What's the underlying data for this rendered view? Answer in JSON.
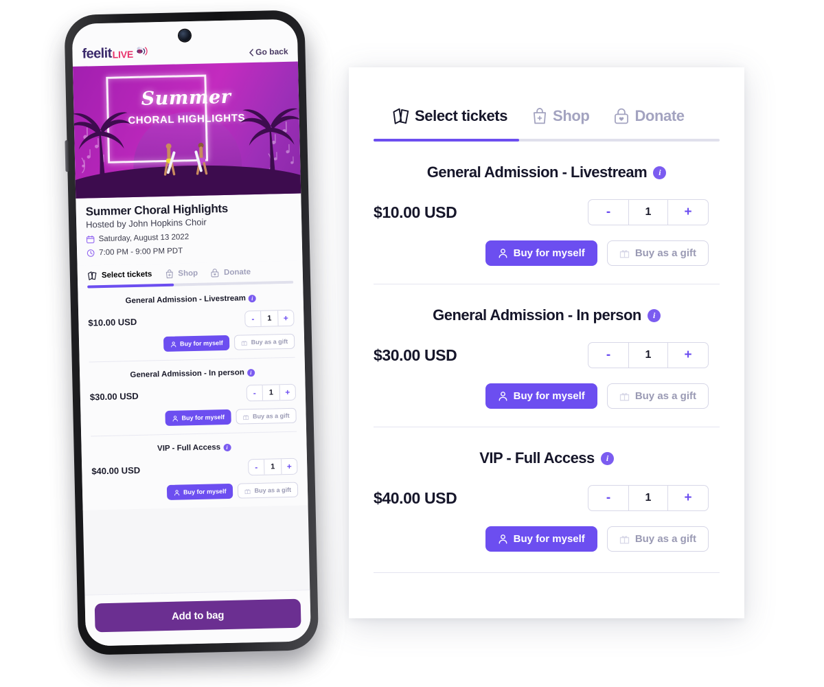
{
  "brand": {
    "logo_primary": "feelit",
    "logo_secondary": "LIVE",
    "accent_purple": "#6C4EF0",
    "accent_dark_purple": "#6B2F91",
    "accent_pink": "#E8356D",
    "muted": "#A0A0BB"
  },
  "phone": {
    "go_back_label": "Go back",
    "hero": {
      "title_script": "Summer",
      "title_caps": "CHORAL HIGHLIGHTS"
    },
    "event": {
      "title": "Summer Choral Highlights",
      "host": "Hosted by John Hopkins Choir",
      "date": "Saturday, August 13 2022",
      "time": "7:00 PM - 9:00 PM PDT"
    },
    "footer": {
      "add_to_bag_label": "Add to bag"
    }
  },
  "tabs": [
    {
      "label": "Select tickets",
      "icon": "tickets-icon",
      "active": true
    },
    {
      "label": "Shop",
      "icon": "shopping-bag-plus-icon",
      "active": false
    },
    {
      "label": "Donate",
      "icon": "donation-box-heart-icon",
      "active": false
    }
  ],
  "tabbar": {
    "progress_percent": 42
  },
  "buttons": {
    "buy_for_myself": "Buy for myself",
    "buy_as_a_gift": "Buy as a gift"
  },
  "stepper": {
    "decrement_label": "-",
    "increment_label": "+"
  },
  "info_badge_label": "i",
  "tickets": [
    {
      "name": "General Admission - Livestream",
      "price": "$10.00 USD",
      "quantity": "1"
    },
    {
      "name": "General Admission - In person",
      "price": "$30.00 USD",
      "quantity": "1"
    },
    {
      "name": "VIP - Full Access",
      "price": "$40.00 USD",
      "quantity": "1"
    }
  ]
}
